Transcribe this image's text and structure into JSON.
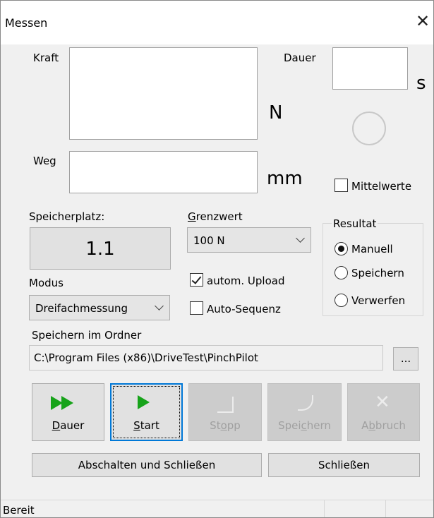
{
  "window": {
    "title": "Messen",
    "close_icon": "close-icon"
  },
  "kraft": {
    "label": "Kraft",
    "unit": "N"
  },
  "dauer": {
    "label": "Dauer",
    "unit": "s"
  },
  "weg": {
    "label": "Weg",
    "unit": "mm"
  },
  "mittelwerte": {
    "label": "Mittelwerte",
    "checked": false
  },
  "speicherplatz": {
    "label": "Speicherplatz:",
    "value": "1.1"
  },
  "grenzwert": {
    "label_first": "G",
    "label_rest": "renzwert",
    "value": "100 N"
  },
  "resultat": {
    "label": "Resultat",
    "options": [
      {
        "label": "Manuell",
        "checked": true
      },
      {
        "label": "Speichern",
        "checked": false
      },
      {
        "label": "Verwerfen",
        "checked": false
      }
    ]
  },
  "modus": {
    "label": "Modus",
    "value": "Dreifachmessung"
  },
  "autom_upload": {
    "label": "autom. Upload",
    "checked": true
  },
  "auto_sequenz": {
    "label": "Auto-Sequenz",
    "checked": false
  },
  "ordner": {
    "label": "Speichern im Ordner",
    "path": "C:\\Program Files (x86)\\DriveTest\\PinchPilot",
    "browse_label": "..."
  },
  "actions": {
    "dauer": {
      "first": "D",
      "rest": "auer"
    },
    "start": {
      "first": "S",
      "rest": "tart"
    },
    "stopp": {
      "before": "St",
      "underline": "o",
      "after": "pp"
    },
    "speichern": {
      "before": "Spei",
      "underline": "c",
      "after": "hern"
    },
    "abbruch": {
      "before": "A",
      "underline": "b",
      "after": "bruch"
    }
  },
  "footer": {
    "abschalten": "Abschalten und Schließen",
    "schliessen": "Schließen"
  },
  "status": {
    "text": "Bereit"
  },
  "colors": {
    "play_green": "#17a31a",
    "focus_blue": "#0078d7",
    "dialog_bg": "#f0f0f0"
  }
}
